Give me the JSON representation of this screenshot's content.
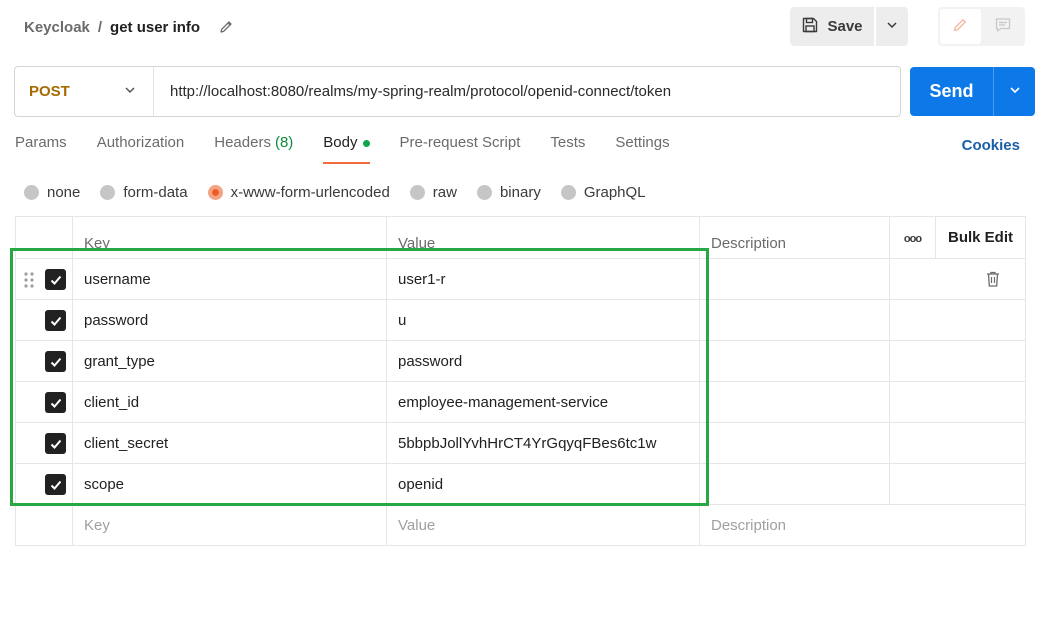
{
  "breadcrumb": {
    "parent": "Keycloak",
    "separator": "/",
    "current": "get user info"
  },
  "toolbar": {
    "save_label": "Save"
  },
  "request": {
    "method": "POST",
    "url": "http://localhost:8080/realms/my-spring-realm/protocol/openid-connect/token",
    "send_label": "Send"
  },
  "tabs": [
    {
      "label": "Params"
    },
    {
      "label": "Authorization"
    },
    {
      "label": "Headers",
      "count": "(8)"
    },
    {
      "label": "Body"
    },
    {
      "label": "Pre-request Script"
    },
    {
      "label": "Tests"
    },
    {
      "label": "Settings"
    }
  ],
  "cookies_label": "Cookies",
  "body_types": [
    "none",
    "form-data",
    "x-www-form-urlencoded",
    "raw",
    "binary",
    "GraphQL"
  ],
  "selected_body_type": "x-www-form-urlencoded",
  "table": {
    "headers": {
      "key": "Key",
      "value": "Value",
      "description": "Description",
      "bulk_edit": "Bulk Edit",
      "more": "ooo"
    },
    "rows": [
      {
        "key": "username",
        "value": "user1-r"
      },
      {
        "key": "password",
        "value": "u"
      },
      {
        "key": "grant_type",
        "value": "password"
      },
      {
        "key": "client_id",
        "value": "employee-management-service"
      },
      {
        "key": "client_secret",
        "value": "5bbpbJollYvhHrCT4YrGqyqFBes6tc1w"
      },
      {
        "key": "scope",
        "value": "openid"
      }
    ],
    "placeholders": {
      "key": "Key",
      "value": "Value",
      "description": "Description"
    }
  },
  "colors": {
    "accent": "#f26b3a",
    "send": "#0d79e8",
    "method": "#a56b00",
    "highlight": "#28a745",
    "count": "#0a8a3d"
  }
}
